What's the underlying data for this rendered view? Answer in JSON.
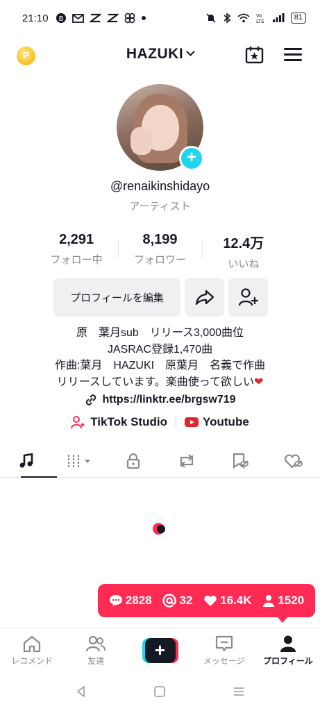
{
  "status_bar": {
    "time": "21:10",
    "left_icons": [
      "badge-icon",
      "mail-icon",
      "capcut-icon",
      "capcut-icon",
      "pinwheel-icon",
      "dot-icon"
    ],
    "battery": "81"
  },
  "header": {
    "account_name": "HAZUKI",
    "coin_label": "P"
  },
  "profile": {
    "username": "@renaikinshidayo",
    "category": "アーティスト",
    "stats": [
      {
        "value": "2,291",
        "label": "フォロー中"
      },
      {
        "value": "8,199",
        "label": "フォロワー"
      },
      {
        "value": "12.4万",
        "label": "いいね"
      }
    ],
    "edit_button": "プロフィールを編集",
    "bio": [
      "原　葉月sub　リリース3,000曲位",
      "JASRAC登録1,470曲",
      "作曲:葉月　HAZUKI　原葉月　名義で作曲",
      "リリースしています。楽曲使って欲しい"
    ],
    "bio_heart": "❤",
    "link": "https://linktr.ee/brgsw719",
    "extra_links": [
      "TikTok Studio",
      "Youtube"
    ]
  },
  "tabs": [
    "music-tab",
    "playlist-tab",
    "private-tab",
    "repost-tab",
    "favorites-tab",
    "liked-tab"
  ],
  "notification": {
    "comments": "2828",
    "mentions": "32",
    "likes": "16.4K",
    "followers": "1520"
  },
  "bottom_nav": [
    {
      "label": "レコメンド"
    },
    {
      "label": "友達"
    },
    {
      "label": ""
    },
    {
      "label": "メッセージ"
    },
    {
      "label": "プロフィール"
    }
  ],
  "colors": {
    "accent": "#fe2c55",
    "cyan": "#20d5ec",
    "text": "#161823",
    "muted": "#8a8b91"
  }
}
